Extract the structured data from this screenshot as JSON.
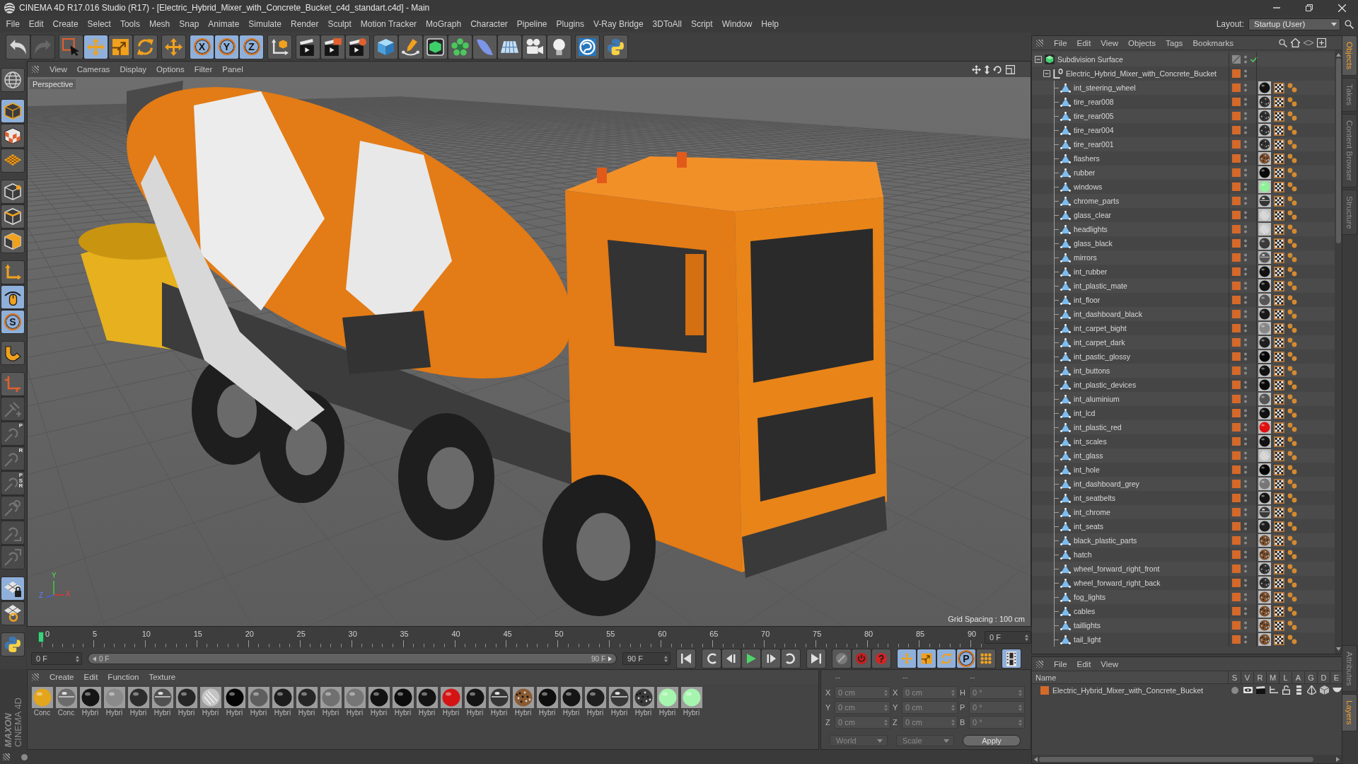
{
  "window": {
    "title": "CINEMA 4D R17.016 Studio (R17) - [Electric_Hybrid_Mixer_with_Concrete_Bucket_c4d_standart.c4d] - Main"
  },
  "menu_bar": {
    "items": [
      "File",
      "Edit",
      "Create",
      "Select",
      "Tools",
      "Mesh",
      "Snap",
      "Animate",
      "Simulate",
      "Render",
      "Sculpt",
      "Motion Tracker",
      "MoGraph",
      "Character",
      "Pipeline",
      "Plugins",
      "V-Ray Bridge",
      "3DToAll",
      "Script",
      "Window",
      "Help"
    ],
    "layout_label": "Layout:",
    "layout_value": "Startup (User)"
  },
  "toolbar": {
    "groups": [
      {
        "items": [
          {
            "kind": "undo",
            "selected": false,
            "disabled": false
          },
          {
            "kind": "redo",
            "selected": false,
            "disabled": true
          }
        ]
      },
      {
        "items": [
          {
            "kind": "select",
            "selected": false,
            "disabled": false
          },
          {
            "kind": "move",
            "selected": true,
            "disabled": false
          },
          {
            "kind": "scale",
            "selected": false,
            "disabled": false
          },
          {
            "kind": "rotate",
            "selected": false,
            "disabled": false
          }
        ]
      },
      {
        "items": [
          {
            "kind": "transform",
            "selected": false,
            "disabled": false
          }
        ]
      },
      {
        "items": [
          {
            "kind": "axis",
            "label": "X",
            "selected": true,
            "disabled": false
          },
          {
            "kind": "axis",
            "label": "Y",
            "selected": true,
            "disabled": false
          },
          {
            "kind": "axis",
            "label": "Z",
            "selected": true,
            "disabled": false
          }
        ]
      },
      {
        "items": [
          {
            "kind": "coordinates",
            "selected": false,
            "disabled": false
          }
        ]
      },
      {
        "items": [
          {
            "kind": "render",
            "selected": false,
            "disabled": false
          },
          {
            "kind": "region",
            "selected": false,
            "disabled": false
          },
          {
            "kind": "settings",
            "selected": false,
            "disabled": false
          }
        ]
      },
      {
        "items": [
          {
            "kind": "cube",
            "selected": false,
            "disabled": false
          },
          {
            "kind": "pen",
            "selected": false,
            "disabled": false
          },
          {
            "kind": "subdivision",
            "selected": false,
            "disabled": false
          },
          {
            "kind": "cloner",
            "selected": false,
            "disabled": false
          },
          {
            "kind": "deformer",
            "selected": false,
            "disabled": false
          },
          {
            "kind": "floor",
            "selected": false,
            "disabled": false
          },
          {
            "kind": "camera",
            "selected": false,
            "disabled": false
          },
          {
            "kind": "light",
            "selected": false,
            "disabled": false
          }
        ]
      },
      {
        "items": [
          {
            "kind": "sketch",
            "selected": false,
            "disabled": false
          }
        ]
      },
      {
        "items": [
          {
            "kind": "python",
            "selected": false,
            "disabled": false
          }
        ]
      }
    ]
  },
  "tool_palette": {
    "groups": [
      {
        "items": [
          {
            "kind": "globe",
            "selected": false,
            "disabled": false
          }
        ]
      },
      {
        "items": [
          {
            "kind": "model",
            "selected": true,
            "disabled": false
          },
          {
            "kind": "texture",
            "selected": false,
            "disabled": false
          },
          {
            "kind": "workplane",
            "selected": false,
            "disabled": false
          }
        ]
      },
      {
        "items": [
          {
            "kind": "points",
            "selected": false,
            "disabled": false
          },
          {
            "kind": "edges",
            "selected": false,
            "disabled": false
          },
          {
            "kind": "polygons",
            "selected": false,
            "disabled": false
          }
        ]
      },
      {
        "items": [
          {
            "kind": "axisedit",
            "selected": false,
            "disabled": false
          },
          {
            "kind": "tweak",
            "selected": true,
            "disabled": false
          },
          {
            "kind": "solo",
            "label": "S",
            "selected": true,
            "disabled": false
          }
        ]
      },
      {
        "items": [
          {
            "kind": "magnet",
            "selected": false,
            "disabled": false
          }
        ]
      },
      {
        "items": [
          {
            "kind": "planes",
            "selected": false,
            "disabled": false
          },
          {
            "kind": "child",
            "selected": false,
            "disabled": true
          },
          {
            "kind": "param",
            "label": "P",
            "selected": false,
            "disabled": true
          },
          {
            "kind": "param",
            "label": "R",
            "selected": false,
            "disabled": true
          },
          {
            "kind": "param",
            "label": "PSR",
            "selected": false,
            "disabled": true
          },
          {
            "kind": "target",
            "selected": false,
            "disabled": true
          },
          {
            "kind": "arc",
            "selected": false,
            "disabled": true
          },
          {
            "kind": "arrow",
            "selected": false,
            "disabled": true
          }
        ]
      },
      {
        "items": [
          {
            "kind": "gridlock",
            "selected": true,
            "disabled": false
          },
          {
            "kind": "gridring",
            "selected": false,
            "disabled": false
          }
        ]
      },
      {
        "items": [
          {
            "kind": "python",
            "selected": false,
            "disabled": false
          }
        ]
      }
    ]
  },
  "viewport": {
    "menu": [
      "View",
      "Cameras",
      "Display",
      "Options",
      "Filter",
      "Panel"
    ],
    "camera": "Perspective",
    "grid_spacing": "Grid Spacing : 100 cm",
    "axes": [
      "X",
      "Y",
      "Z"
    ]
  },
  "timeline": {
    "ticks": [
      "0",
      "5",
      "10",
      "15",
      "20",
      "25",
      "30",
      "35",
      "40",
      "45",
      "50",
      "55",
      "60",
      "65",
      "70",
      "75",
      "80",
      "85",
      "90"
    ],
    "level": 0,
    "current": "0 F"
  },
  "playback": {
    "start": "0 F",
    "range_start": "0 F",
    "range_end": "90 F",
    "level": 1,
    "end": "90 F",
    "groups": [
      {
        "items": [
          {
            "kind": "start",
            "selected": false
          }
        ]
      },
      {
        "items": [
          {
            "kind": "loopback",
            "selected": false
          },
          {
            "kind": "stepback",
            "selected": false
          },
          {
            "kind": "play",
            "selected": false
          },
          {
            "kind": "stepforward",
            "selected": false
          },
          {
            "kind": "loopforward",
            "selected": false
          }
        ]
      },
      {
        "items": [
          {
            "kind": "end",
            "selected": false
          }
        ]
      },
      {
        "items": [
          {
            "kind": "keyoff",
            "selected": false
          },
          {
            "kind": "record",
            "selected": false
          },
          {
            "kind": "autokey",
            "selected": false
          }
        ]
      },
      {
        "items": [
          {
            "kind": "movekey",
            "selected": true
          },
          {
            "kind": "scalekey",
            "selected": true
          },
          {
            "kind": "rotatekey",
            "selected": true
          },
          {
            "kind": "paramkey",
            "label": "P",
            "selected": true
          },
          {
            "kind": "pointkey",
            "selected": false
          }
        ]
      },
      {
        "items": [
          {
            "kind": "timeline",
            "selected": true
          }
        ]
      }
    ]
  },
  "logo": {
    "brand": "MAXON",
    "product": "CINEMA 4D"
  },
  "material_manager": {
    "menu": [
      "Create",
      "Edit",
      "Function",
      "Texture"
    ],
    "materials": [
      {
        "label": "Conc",
        "color": "#e3a51c",
        "kind": "gloss"
      },
      {
        "label": "Conc",
        "color": "#6b6b6b",
        "kind": "chrome"
      },
      {
        "label": "Hybri",
        "color": "#151515",
        "kind": "gloss"
      },
      {
        "label": "Hybri",
        "color": "#8a8a8a",
        "kind": "gloss"
      },
      {
        "label": "Hybri",
        "color": "#2d2d2d",
        "kind": "gloss"
      },
      {
        "label": "Hybri",
        "color": "#505050",
        "kind": "chrome"
      },
      {
        "label": "Hybri",
        "color": "#262626",
        "kind": "gloss"
      },
      {
        "label": "Hybri",
        "color": "#c4c4c4",
        "kind": "glass"
      },
      {
        "label": "Hybri",
        "color": "#050505",
        "kind": "gloss"
      },
      {
        "label": "Hybri",
        "color": "#5e5e5e",
        "kind": "gloss"
      },
      {
        "label": "Hybri",
        "color": "#1c1c1c",
        "kind": "gloss"
      },
      {
        "label": "Hybri",
        "color": "#262626",
        "kind": "gloss"
      },
      {
        "label": "Hybri",
        "color": "#707070",
        "kind": "gloss"
      },
      {
        "label": "Hybri",
        "color": "#767676",
        "kind": "gloss"
      },
      {
        "label": "Hybri",
        "color": "#121212",
        "kind": "gloss"
      },
      {
        "label": "Hybri",
        "color": "#0c0c0c",
        "kind": "gloss"
      },
      {
        "label": "Hybri",
        "color": "#141414",
        "kind": "gloss"
      },
      {
        "label": "Hybri",
        "color": "#d41414",
        "kind": "gloss"
      },
      {
        "label": "Hybri",
        "color": "#141414",
        "kind": "gloss"
      },
      {
        "label": "Hybri",
        "color": "#353535",
        "kind": "chrome"
      },
      {
        "label": "Hybri",
        "color": "#8a5a30",
        "kind": "speckle"
      },
      {
        "label": "Hybri",
        "color": "#0e0e0e",
        "kind": "gloss"
      },
      {
        "label": "Hybri",
        "color": "#161616",
        "kind": "gloss"
      },
      {
        "label": "Hybri",
        "color": "#1e1e1e",
        "kind": "gloss"
      },
      {
        "label": "Hybri",
        "color": "#383838",
        "kind": "chrome"
      },
      {
        "label": "Hybri",
        "color": "#3a3a3a",
        "kind": "speckle"
      },
      {
        "label": "Hybri",
        "color": "#a6f5ae",
        "kind": "gloss"
      },
      {
        "label": "Hybri",
        "color": "#a6f5ae",
        "kind": "gloss"
      }
    ]
  },
  "coordinates": {
    "headers": [
      "--",
      "--",
      "--"
    ],
    "rows": [
      {
        "position_label": "X",
        "position": "0 cm",
        "size_label": "X",
        "size": "0 cm",
        "rotation_label": "H",
        "rotation": "0 °"
      },
      {
        "position_label": "Y",
        "position": "0 cm",
        "size_label": "Y",
        "size": "0 cm",
        "rotation_label": "P",
        "rotation": "0 °"
      },
      {
        "position_label": "Z",
        "position": "0 cm",
        "size_label": "Z",
        "size": "0 cm",
        "rotation_label": "B",
        "rotation": "0 °"
      }
    ],
    "space": "World",
    "mode": "Scale",
    "apply": "Apply"
  },
  "object_manager": {
    "menu": [
      "File",
      "Edit",
      "View",
      "Objects",
      "Tags",
      "Bookmarks"
    ],
    "tree": [
      {
        "name": "Subdivision Surface",
        "kind": "generator",
        "expanded": true,
        "enabled": true,
        "children": [
          {
            "name": "Electric_Hybrid_Mixer_with_Concrete_Bucket",
            "kind": "null",
            "expanded": true,
            "children": [
              {
                "name": "int_steering_wheel",
                "kind": "polygon",
                "material": {
                  "color": "#121212",
                  "kind": "gloss"
                }
              },
              {
                "name": "tire_rear008",
                "kind": "polygon",
                "material": {
                  "color": "#333333",
                  "kind": "speckle"
                }
              },
              {
                "name": "tire_rear005",
                "kind": "polygon",
                "material": {
                  "color": "#333333",
                  "kind": "speckle"
                }
              },
              {
                "name": "tire_rear004",
                "kind": "polygon",
                "material": {
                  "color": "#333333",
                  "kind": "speckle"
                }
              },
              {
                "name": "tire_rear001",
                "kind": "polygon",
                "material": {
                  "color": "#333333",
                  "kind": "speckle"
                }
              },
              {
                "name": "flashers",
                "kind": "polygon",
                "material": {
                  "color": "#7a5030",
                  "kind": "speckle"
                }
              },
              {
                "name": "rubber",
                "kind": "polygon",
                "material": {
                  "color": "#0a0a0a",
                  "kind": "gloss"
                }
              },
              {
                "name": "windows",
                "kind": "polygon",
                "material": {
                  "color": "#90f09a",
                  "kind": "gloss"
                }
              },
              {
                "name": "chrome_parts",
                "kind": "polygon",
                "material": {
                  "color": "#353535",
                  "kind": "chrome"
                }
              },
              {
                "name": "glass_clear",
                "kind": "polygon",
                "material": {
                  "color": "#cfcfcf",
                  "kind": "glass"
                }
              },
              {
                "name": "headlights",
                "kind": "polygon",
                "material": {
                  "color": "#cfcfcf",
                  "kind": "glass"
                }
              },
              {
                "name": "glass_black",
                "kind": "polygon",
                "material": {
                  "color": "#3a3a3a",
                  "kind": "gloss"
                }
              },
              {
                "name": "mirrors",
                "kind": "polygon",
                "material": {
                  "color": "#555555",
                  "kind": "chrome"
                }
              },
              {
                "name": "int_rubber",
                "kind": "polygon",
                "material": {
                  "color": "#111111",
                  "kind": "gloss"
                }
              },
              {
                "name": "int_plastic_mate",
                "kind": "polygon",
                "material": {
                  "color": "#111111",
                  "kind": "gloss"
                }
              },
              {
                "name": "int_floor",
                "kind": "polygon",
                "material": {
                  "color": "#555555",
                  "kind": "gloss"
                }
              },
              {
                "name": "int_dashboard_black",
                "kind": "polygon",
                "material": {
                  "color": "#1a1a1a",
                  "kind": "gloss"
                }
              },
              {
                "name": "int_carpet_bight",
                "kind": "polygon",
                "material": {
                  "color": "#888888",
                  "kind": "gloss"
                }
              },
              {
                "name": "int_carpet_dark",
                "kind": "polygon",
                "material": {
                  "color": "#1e1e1e",
                  "kind": "gloss"
                }
              },
              {
                "name": "int_pastic_glossy",
                "kind": "polygon",
                "material": {
                  "color": "#050505",
                  "kind": "gloss"
                }
              },
              {
                "name": "int_buttons",
                "kind": "polygon",
                "material": {
                  "color": "#111111",
                  "kind": "gloss"
                }
              },
              {
                "name": "int_plastic_devices",
                "kind": "polygon",
                "material": {
                  "color": "#0a0a0a",
                  "kind": "gloss"
                }
              },
              {
                "name": "int_aluminium",
                "kind": "polygon",
                "material": {
                  "color": "#555555",
                  "kind": "gloss"
                }
              },
              {
                "name": "int_lcd",
                "kind": "polygon",
                "material": {
                  "color": "#111111",
                  "kind": "gloss"
                }
              },
              {
                "name": "int_plastic_red",
                "kind": "polygon",
                "material": {
                  "color": "#e01010",
                  "kind": "gloss"
                }
              },
              {
                "name": "int_scales",
                "kind": "polygon",
                "material": {
                  "color": "#111111",
                  "kind": "gloss"
                }
              },
              {
                "name": "int_glass",
                "kind": "polygon",
                "material": {
                  "color": "#cfcfcf",
                  "kind": "glass"
                }
              },
              {
                "name": "int_hole",
                "kind": "polygon",
                "material": {
                  "color": "#050505",
                  "kind": "gloss"
                }
              },
              {
                "name": "int_dashboard_grey",
                "kind": "polygon",
                "material": {
                  "color": "#777777",
                  "kind": "gloss"
                }
              },
              {
                "name": "int_seatbelts",
                "kind": "polygon",
                "material": {
                  "color": "#151515",
                  "kind": "gloss"
                }
              },
              {
                "name": "int_chrome",
                "kind": "polygon",
                "material": {
                  "color": "#3a3a3a",
                  "kind": "chrome"
                }
              },
              {
                "name": "int_seats",
                "kind": "polygon",
                "material": {
                  "color": "#1e1e1e",
                  "kind": "gloss"
                }
              },
              {
                "name": "black_plastic_parts",
                "kind": "polygon",
                "material": {
                  "color": "#7a5030",
                  "kind": "speckle"
                }
              },
              {
                "name": "hatch",
                "kind": "polygon",
                "material": {
                  "color": "#7a5030",
                  "kind": "speckle"
                }
              },
              {
                "name": "wheel_forward_right_front",
                "kind": "polygon",
                "material": {
                  "color": "#333333",
                  "kind": "speckle"
                }
              },
              {
                "name": "wheel_forward_right_back",
                "kind": "polygon",
                "material": {
                  "color": "#333333",
                  "kind": "speckle"
                }
              },
              {
                "name": "fog_lights",
                "kind": "polygon",
                "material": {
                  "color": "#7a5030",
                  "kind": "speckle"
                }
              },
              {
                "name": "cables",
                "kind": "polygon",
                "material": {
                  "color": "#7a5030",
                  "kind": "speckle"
                }
              },
              {
                "name": "taillights",
                "kind": "polygon",
                "material": {
                  "color": "#7a5030",
                  "kind": "speckle"
                }
              },
              {
                "name": "tail_light",
                "kind": "polygon",
                "material": {
                  "color": "#7a5030",
                  "kind": "speckle"
                }
              }
            ]
          }
        ]
      }
    ]
  },
  "layer_manager": {
    "menu": [
      "File",
      "Edit",
      "View"
    ],
    "columns": [
      "Name",
      "S",
      "V",
      "R",
      "M",
      "L",
      "A",
      "G",
      "D",
      "E"
    ],
    "layers": [
      {
        "name": "Electric_Hybrid_Mixer_with_Concrete_Bucket",
        "color": "#d4692a"
      }
    ]
  },
  "side_tabs": {
    "top": [
      {
        "label": "Objects",
        "selected": true
      },
      {
        "label": "Takes",
        "selected": false
      },
      {
        "label": "Content Browser",
        "selected": false
      },
      {
        "label": "Structure",
        "selected": false
      }
    ],
    "bottom": [
      {
        "label": "Attributes",
        "selected": false
      },
      {
        "label": "Layers",
        "selected": true
      }
    ]
  }
}
